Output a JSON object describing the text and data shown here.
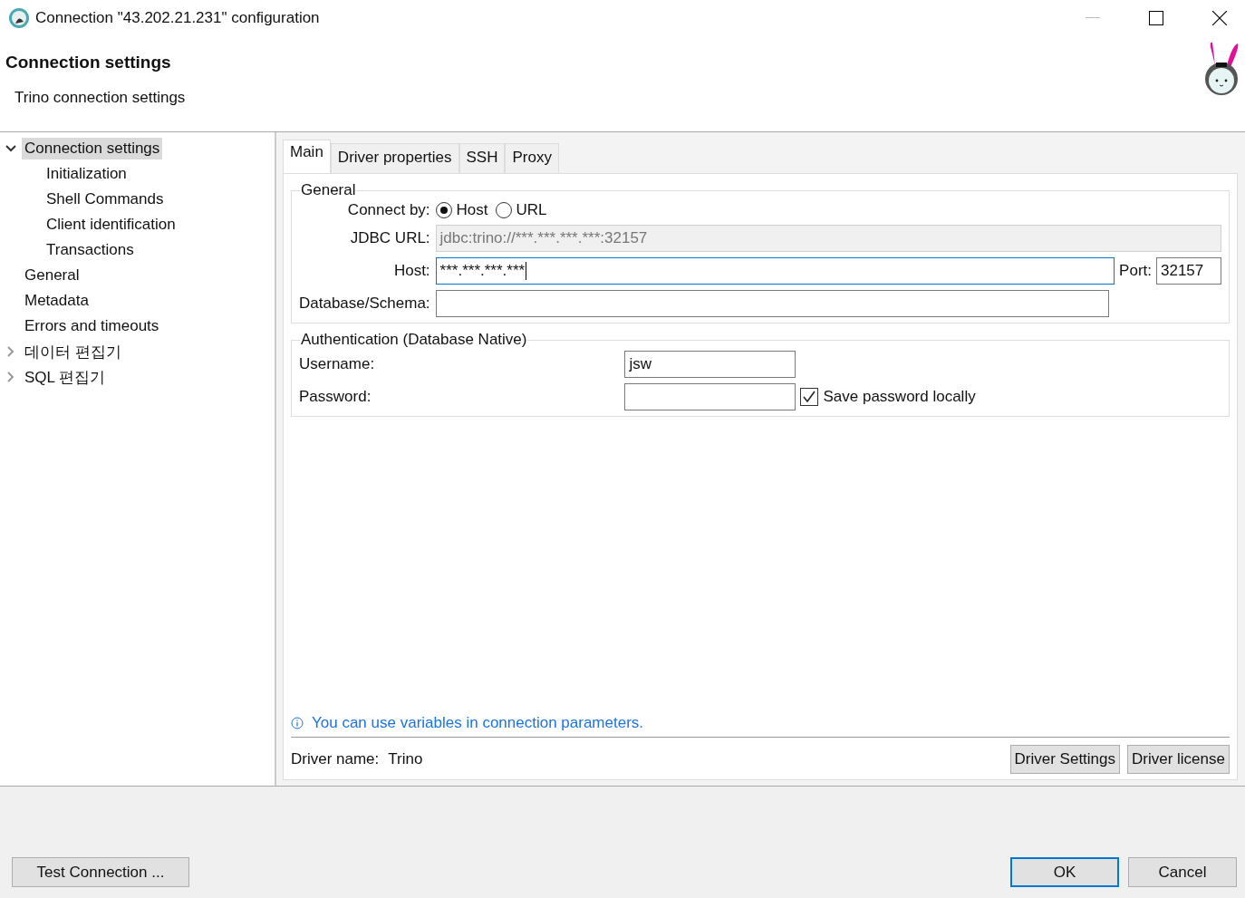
{
  "window": {
    "title": "Connection \"43.202.21.231\" configuration"
  },
  "header": {
    "title": "Connection settings",
    "subtitle": "Trino connection settings"
  },
  "sidebar": {
    "items": [
      {
        "label": "Connection settings",
        "selected": true,
        "expanded": true,
        "children": [
          {
            "label": "Initialization",
            "selected": false
          },
          {
            "label": "Shell Commands",
            "selected": false
          },
          {
            "label": "Client identification",
            "selected": false
          },
          {
            "label": "Transactions",
            "selected": false
          }
        ]
      },
      {
        "label": "General",
        "selected": false
      },
      {
        "label": "Metadata",
        "selected": false
      },
      {
        "label": "Errors and timeouts",
        "selected": false
      },
      {
        "label": "데이터 편집기",
        "selected": false,
        "expanded": false
      },
      {
        "label": "SQL 편집기",
        "selected": false,
        "expanded": false
      }
    ]
  },
  "tabs": [
    {
      "label": "Main",
      "selected": true
    },
    {
      "label": "Driver properties",
      "selected": false
    },
    {
      "label": "SSH",
      "selected": false
    },
    {
      "label": "Proxy",
      "selected": false
    }
  ],
  "general": {
    "legend": "General",
    "connect_by": {
      "label": "Connect by:",
      "options": [
        {
          "label": "Host",
          "selected": true
        },
        {
          "label": "URL",
          "selected": false
        }
      ]
    },
    "jdbc_url": {
      "label": "JDBC URL:",
      "value": "jdbc:trino://***.***.***.***:32157",
      "disabled": true
    },
    "host": {
      "label": "Host:",
      "value": "***.***.***.***",
      "focused": true
    },
    "port": {
      "label": "Port:",
      "value": "32157"
    },
    "database": {
      "label": "Database/Schema:"
    }
  },
  "auth": {
    "legend": "Authentication (Database Native)",
    "username": {
      "label": "Username:",
      "value": "jsw"
    },
    "password": {
      "label": "Password:"
    },
    "save_password": {
      "label": "Save password locally",
      "checked": true
    }
  },
  "info": "You can use variables in connection parameters.",
  "driver": {
    "label": "Driver name:",
    "value": "Trino",
    "buttons": [
      "Driver Settings",
      "Driver license"
    ]
  },
  "footer": {
    "test_button": "Test Connection ...",
    "buttons": [
      {
        "label": "OK",
        "default": true
      },
      {
        "label": "Cancel",
        "default": false
      }
    ]
  }
}
